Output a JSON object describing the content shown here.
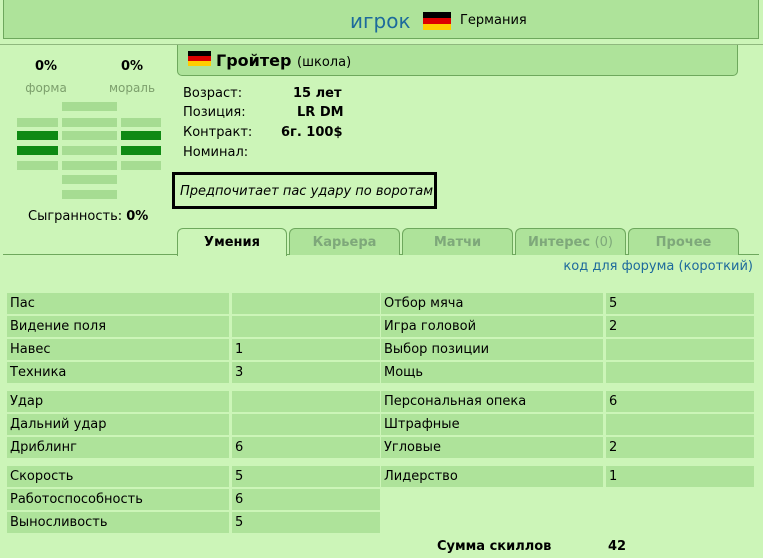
{
  "header": {
    "title": "игрок",
    "country": "Германия"
  },
  "stats": {
    "form": {
      "value": "0%",
      "label": "форма"
    },
    "morale": {
      "value": "0%",
      "label": "мораль"
    },
    "teamwork_label": "Сыгранность:",
    "teamwork_value": "0%"
  },
  "player": {
    "name": "Гройтер",
    "team": "(школа)",
    "info": [
      {
        "key": "Возраст:",
        "value": "15 лет"
      },
      {
        "key": "Позиция:",
        "value": "LR DM"
      },
      {
        "key": "Контракт:",
        "value": "6г. 100$"
      },
      {
        "key": "Номинал:",
        "value": ""
      }
    ],
    "preference": "Предпочитает пас удару по воротам"
  },
  "tabs": [
    {
      "label": "Умения",
      "active": true
    },
    {
      "label": "Карьера"
    },
    {
      "label": "Матчи"
    },
    {
      "label": "Интерес",
      "count": "(0)"
    },
    {
      "label": "Прочее"
    }
  ],
  "forum": {
    "code_label": "код для форума",
    "short_label": "(короткий)"
  },
  "skills": {
    "left": [
      [
        {
          "name": "Пас",
          "value": ""
        },
        {
          "name": "Видение поля",
          "value": ""
        },
        {
          "name": "Навес",
          "value": "1"
        },
        {
          "name": "Техника",
          "value": "3"
        }
      ],
      [
        {
          "name": "Удар",
          "value": ""
        },
        {
          "name": "Дальний удар",
          "value": ""
        },
        {
          "name": "Дриблинг",
          "value": "6"
        }
      ],
      [
        {
          "name": "Скорость",
          "value": "5"
        },
        {
          "name": "Работоспособность",
          "value": "6"
        },
        {
          "name": "Выносливость",
          "value": "5"
        }
      ]
    ],
    "right": [
      [
        {
          "name": "Отбор мяча",
          "value": "5"
        },
        {
          "name": "Игра головой",
          "value": "2"
        },
        {
          "name": "Выбор позиции",
          "value": ""
        },
        {
          "name": "Мощь",
          "value": ""
        }
      ],
      [
        {
          "name": "Персональная опека",
          "value": "6"
        },
        {
          "name": "Штрафные",
          "value": ""
        },
        {
          "name": "Угловые",
          "value": "2"
        }
      ],
      [
        {
          "name": "Лидерство",
          "value": "1"
        }
      ]
    ],
    "sum_label": "Сумма скиллов",
    "sum_value": "42"
  },
  "colors": {
    "panel": "#aee39a",
    "background": "#ccf5b8",
    "bar_filled": "#0f8a14",
    "link": "#1d6a9c"
  }
}
